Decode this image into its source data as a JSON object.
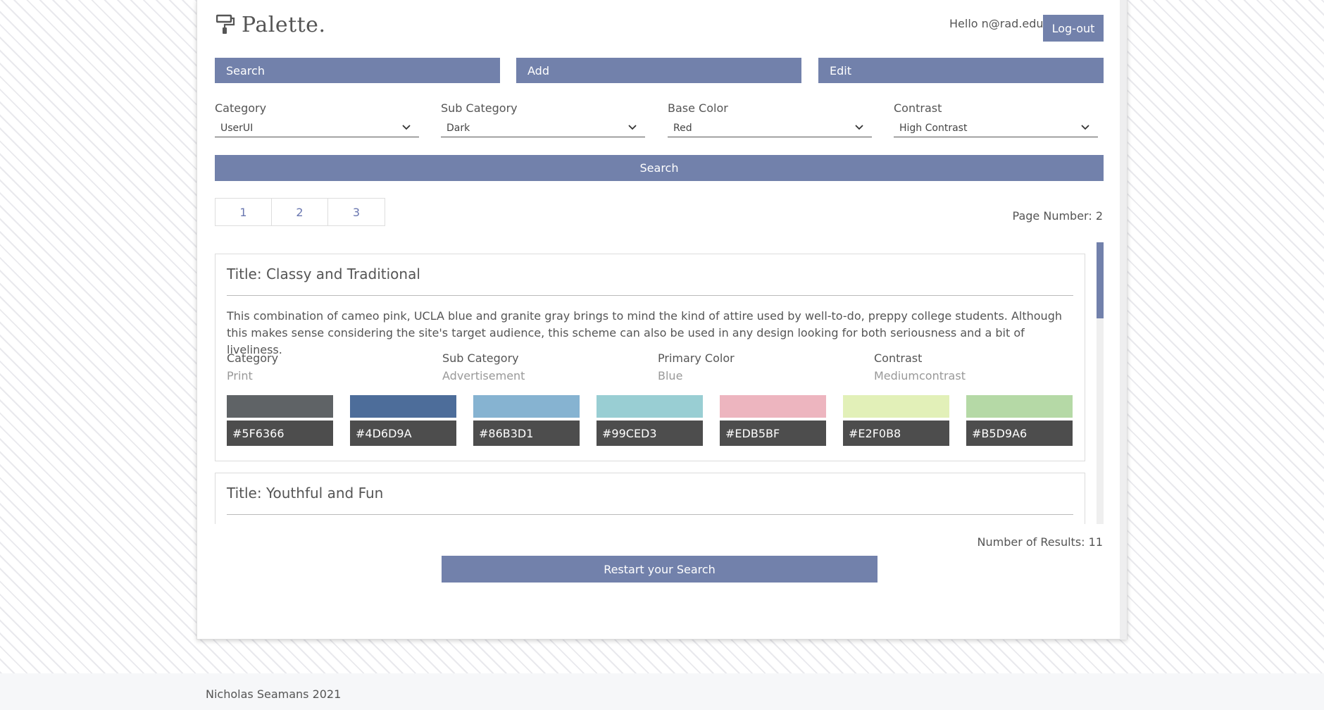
{
  "header": {
    "brand": "Palette.",
    "greeting": "Hello n@rad.edu",
    "logout_label": "Log-out"
  },
  "tabs": [
    {
      "label": "Search"
    },
    {
      "label": "Add"
    },
    {
      "label": "Edit"
    }
  ],
  "filters": [
    {
      "label": "Category",
      "value": "UserUI"
    },
    {
      "label": "Sub Category",
      "value": "Dark"
    },
    {
      "label": "Base Color",
      "value": "Red"
    },
    {
      "label": "Contrast",
      "value": "High Contrast"
    }
  ],
  "search_button": "Search",
  "pagination": {
    "pages": [
      "1",
      "2",
      "3"
    ],
    "page_number_text": "Page Number: 2"
  },
  "results": [
    {
      "title": "Title: Classy and Traditional",
      "description": "This combination of cameo pink, UCLA blue and granite gray brings to mind the kind of attire used by well-to-do, preppy college students. Although this makes sense considering the site's target audience, this scheme can also be used in any design looking for both seriousness and a bit of liveliness.",
      "meta": [
        {
          "label": "Category",
          "value": "Print"
        },
        {
          "label": "Sub Category",
          "value": "Advertisement"
        },
        {
          "label": "Primary Color",
          "value": "Blue"
        },
        {
          "label": "Contrast",
          "value": "Mediumcontrast"
        }
      ],
      "swatches": [
        {
          "hex": "#5F6366",
          "color": "#5f6366"
        },
        {
          "hex": "#4D6D9A",
          "color": "#4d6d9a"
        },
        {
          "hex": "#86B3D1",
          "color": "#86b3d1"
        },
        {
          "hex": "#99CED3",
          "color": "#99ced3"
        },
        {
          "hex": "#EDB5BF",
          "color": "#edb5bf"
        },
        {
          "hex": "#E2F0B8",
          "color": "#e2f0b8"
        },
        {
          "hex": "#B5D9A6",
          "color": "#b5d9a6"
        }
      ]
    },
    {
      "title": "Title: Youthful and Fun"
    }
  ],
  "results_count_text": "Number of Results: 11",
  "restart_label": "Restart your Search",
  "footer": {
    "text": "Nicholas Seamans 2021"
  },
  "colors": {
    "accent": "#7281ab",
    "swatch_label_bg": "#4d4d4d"
  }
}
